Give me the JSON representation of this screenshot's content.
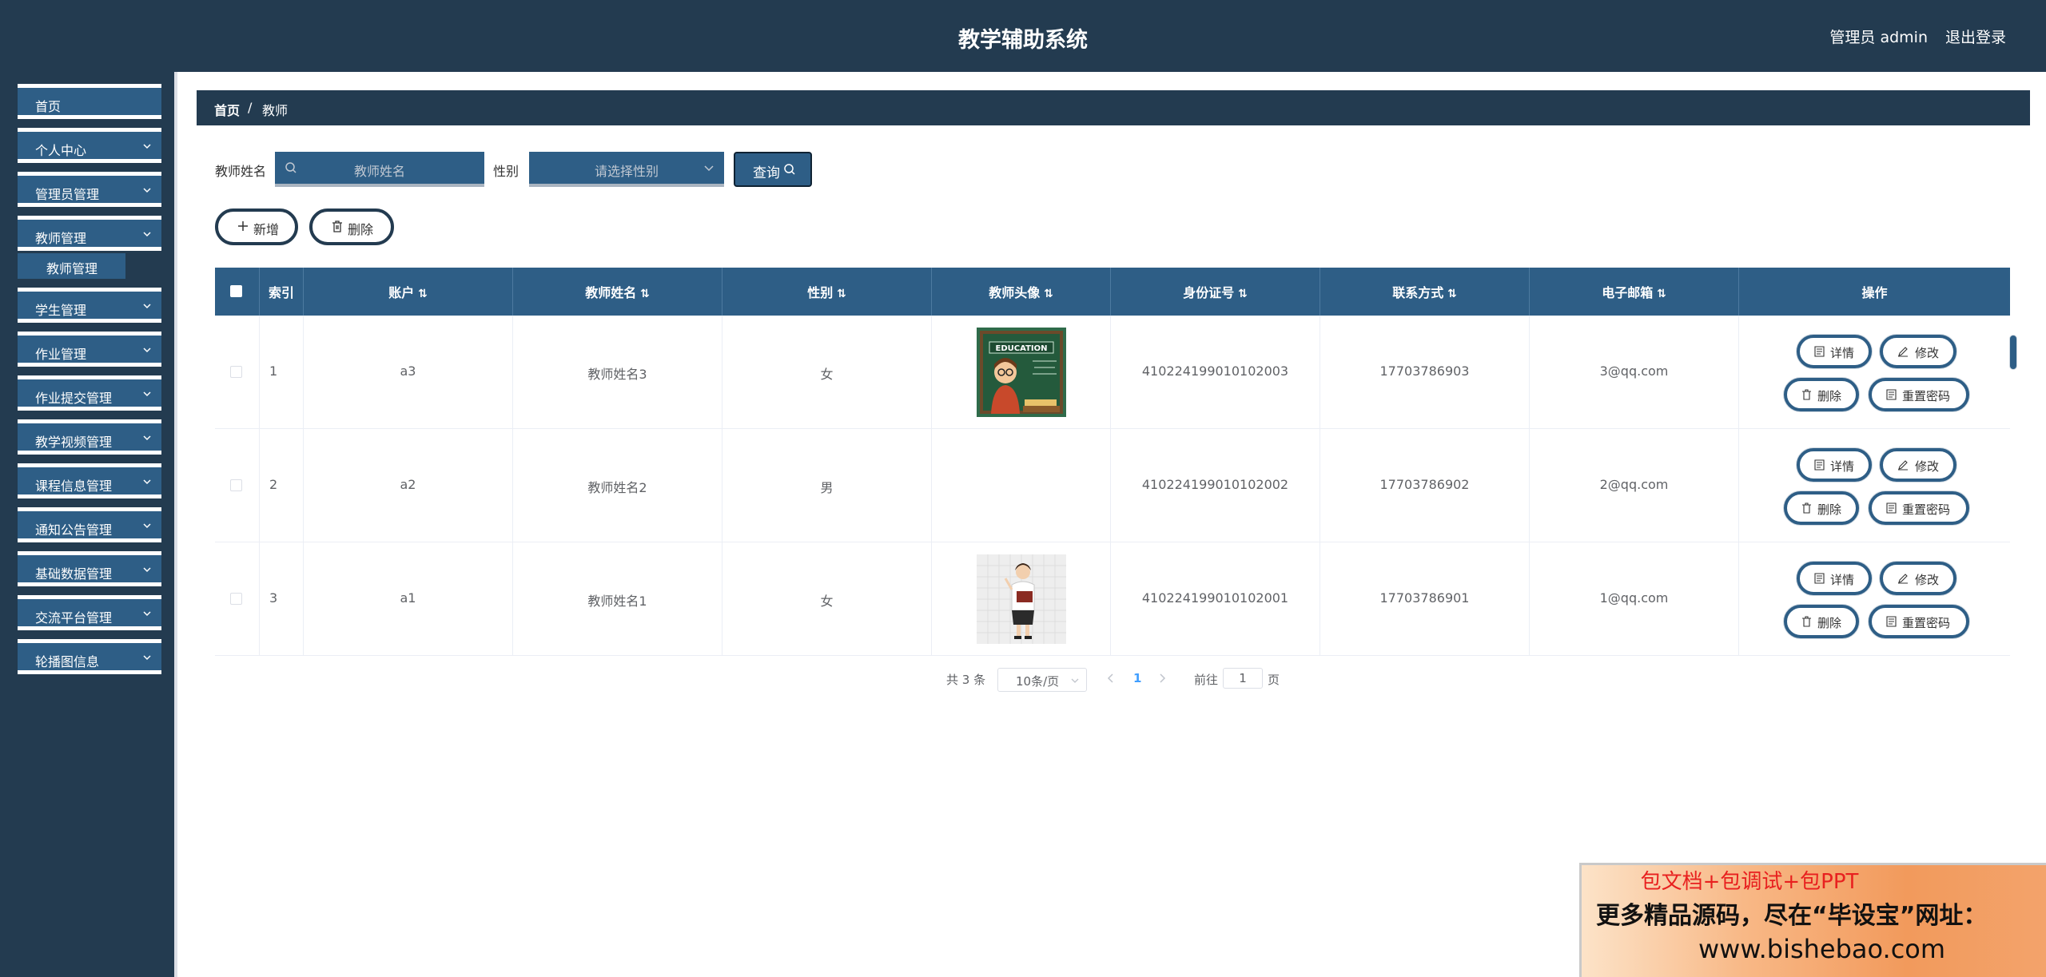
{
  "header": {
    "title": "教学辅助系统",
    "user": "管理员 admin",
    "logout": "退出登录"
  },
  "sidebar": {
    "items": [
      {
        "label": "首页"
      },
      {
        "label": "个人中心"
      },
      {
        "label": "管理员管理"
      },
      {
        "label": "教师管理"
      },
      {
        "label": "学生管理"
      },
      {
        "label": "作业管理"
      },
      {
        "label": "作业提交管理"
      },
      {
        "label": "教学视频管理"
      },
      {
        "label": "课程信息管理"
      },
      {
        "label": "通知公告管理"
      },
      {
        "label": "基础数据管理"
      },
      {
        "label": "交流平台管理"
      },
      {
        "label": "轮播图信息"
      }
    ],
    "sub": {
      "label": "教师管理"
    }
  },
  "breadcrumb": {
    "home": "首页",
    "sep": "/",
    "current": "教师"
  },
  "search": {
    "name_label": "教师姓名",
    "name_placeholder": "教师姓名",
    "gender_label": "性别",
    "gender_placeholder": "请选择性别",
    "query_label": "查询"
  },
  "toolbar": {
    "add_label": "新增",
    "delete_label": "删除"
  },
  "table": {
    "headers": [
      "索引",
      "账户",
      "教师姓名",
      "性别",
      "教师头像",
      "身份证号",
      "联系方式",
      "电子邮箱",
      "操作"
    ],
    "rows": [
      {
        "index": "1",
        "account": "a3",
        "name": "教师姓名3",
        "gender": "女",
        "id_card": "410224199010102003",
        "phone": "17703786903",
        "email": "3@qq.com",
        "avatar": "education-teacher-image"
      },
      {
        "index": "2",
        "account": "a2",
        "name": "教师姓名2",
        "gender": "男",
        "id_card": "410224199010102002",
        "phone": "17703786902",
        "email": "2@qq.com",
        "avatar": ""
      },
      {
        "index": "3",
        "account": "a1",
        "name": "教师姓名1",
        "gender": "女",
        "id_card": "410224199010102001",
        "phone": "17703786901",
        "email": "1@qq.com",
        "avatar": "woman-teacher-image"
      }
    ],
    "actions": {
      "detail": "详情",
      "edit": "修改",
      "delete": "删除",
      "reset": "重置密码"
    }
  },
  "pagination": {
    "total": "共 3 条",
    "page_size": "10条/页",
    "current": "1",
    "goto": "前往",
    "goto_value": "1",
    "page": "页"
  },
  "ad": {
    "line1": "包文档+包调试+包PPT",
    "line2": "更多精品源码，尽在“毕设宝”网址：",
    "line3": "www.bishebao.com"
  },
  "colors": {
    "header_bg": "#233b50",
    "accent": "#2e5e86",
    "current_page": "#409eff"
  }
}
